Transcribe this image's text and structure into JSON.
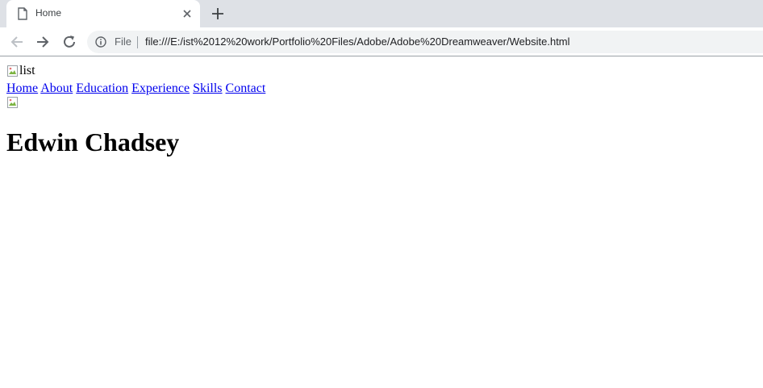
{
  "browser": {
    "tab_title": "Home",
    "file_label": "File",
    "url": "file:///E:/ist%2012%20work/Portfolio%20Files/Adobe/Adobe%20Dreamweaver/Website.html"
  },
  "page": {
    "logo_alt": "list",
    "nav": [
      "Home",
      "About",
      "Education",
      "Experience",
      "Skills",
      "Contact"
    ],
    "heading": "Edwin Chadsey"
  },
  "icons": {
    "tab_page": "page-icon",
    "tab_close": "close-icon",
    "new_tab": "plus-icon",
    "back": "arrow-left-icon",
    "forward": "arrow-right-icon",
    "reload": "reload-icon",
    "info": "info-icon",
    "broken_image": "broken-image-icon"
  },
  "colors": {
    "tabstrip_bg": "#dee1e6",
    "omnibox_bg": "#f1f3f4",
    "link": "#0000ee",
    "text": "#000000"
  }
}
